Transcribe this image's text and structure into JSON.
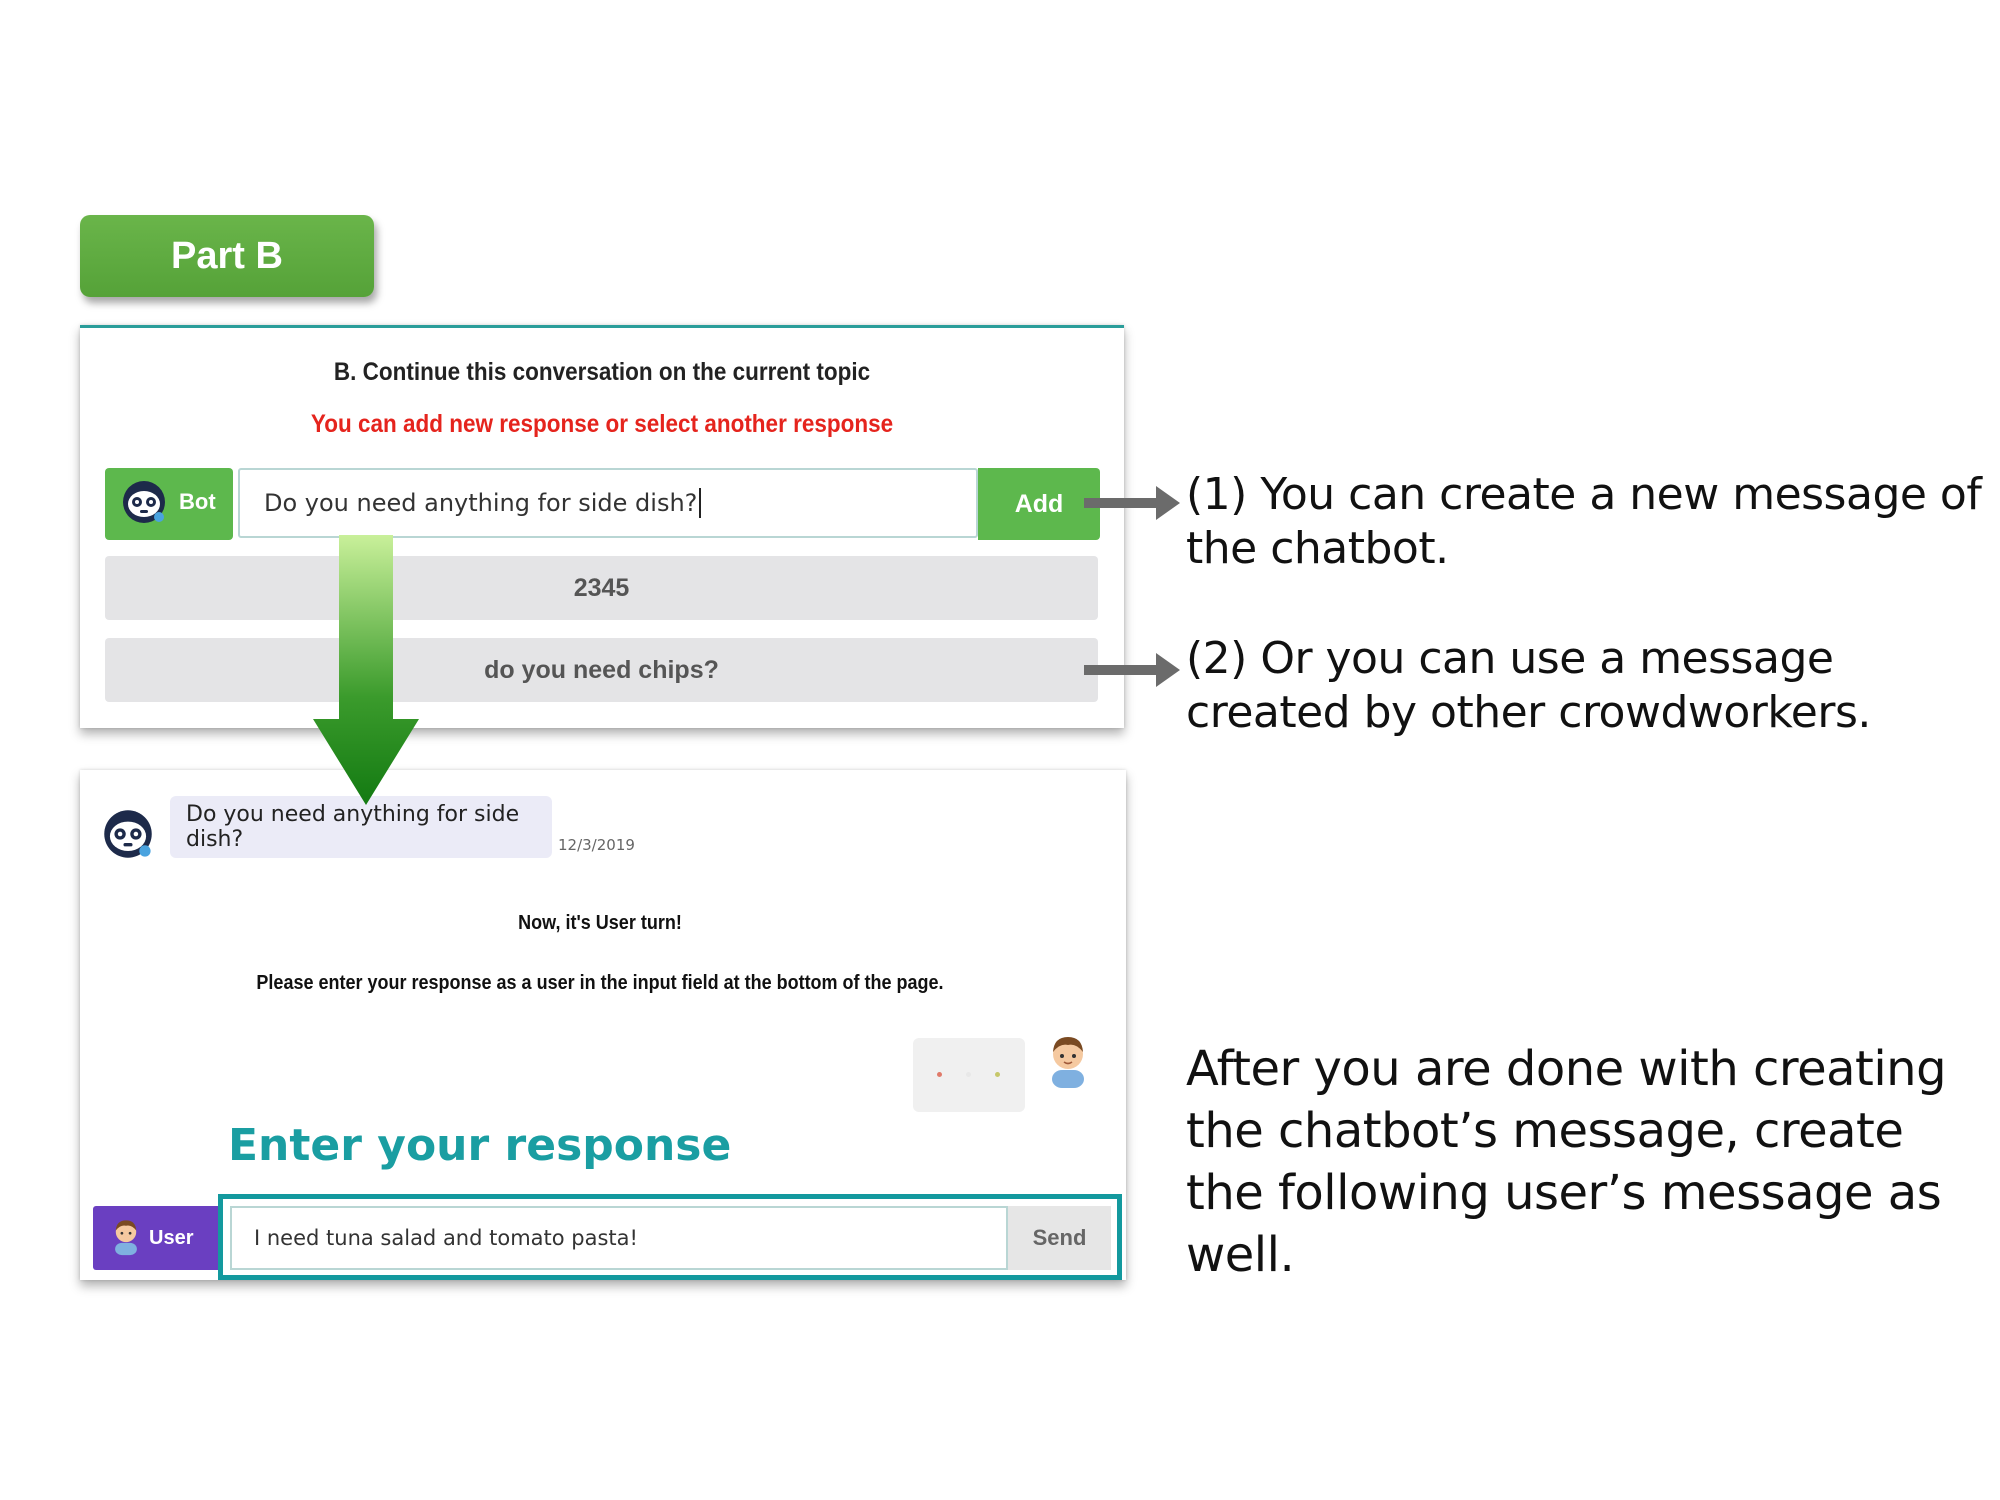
{
  "part_badge": "Part B",
  "task_panel": {
    "title": "B. Continue this conversation on the current topic",
    "subtitle": "You can add new response or select another response",
    "bot_tag": "Bot",
    "message_input_value": "Do you need anything for side dish?",
    "add_button": "Add",
    "response_options": [
      "2345",
      "do you need chips?"
    ]
  },
  "chat_panel": {
    "bot_message": "Do you need anything for side dish?",
    "timestamp": "12/3/2019",
    "turn_title": "Now, it's User turn!",
    "turn_instruction": "Please enter your response as a user in the input field at the bottom of the page.",
    "enter_label": "Enter your response",
    "user_tag": "User",
    "user_input_value": "I need tuna salad and tomato pasta!",
    "send_button": "Send"
  },
  "annotations": {
    "note_1": "(1) You can create a new message of the chatbot.",
    "note_2": "(2) Or you can use a message created by other crowdworkers.",
    "note_3": "After you are done with creating the chatbot’s message, create the following user’s message as well."
  },
  "colors": {
    "green": "#5db84d",
    "teal": "#13999e",
    "red_text": "#e5241d",
    "user_purple": "#6a3fc1"
  },
  "icons": [
    "robot-face-icon",
    "user-face-icon",
    "arrow-right-icon",
    "arrow-down-icon"
  ]
}
